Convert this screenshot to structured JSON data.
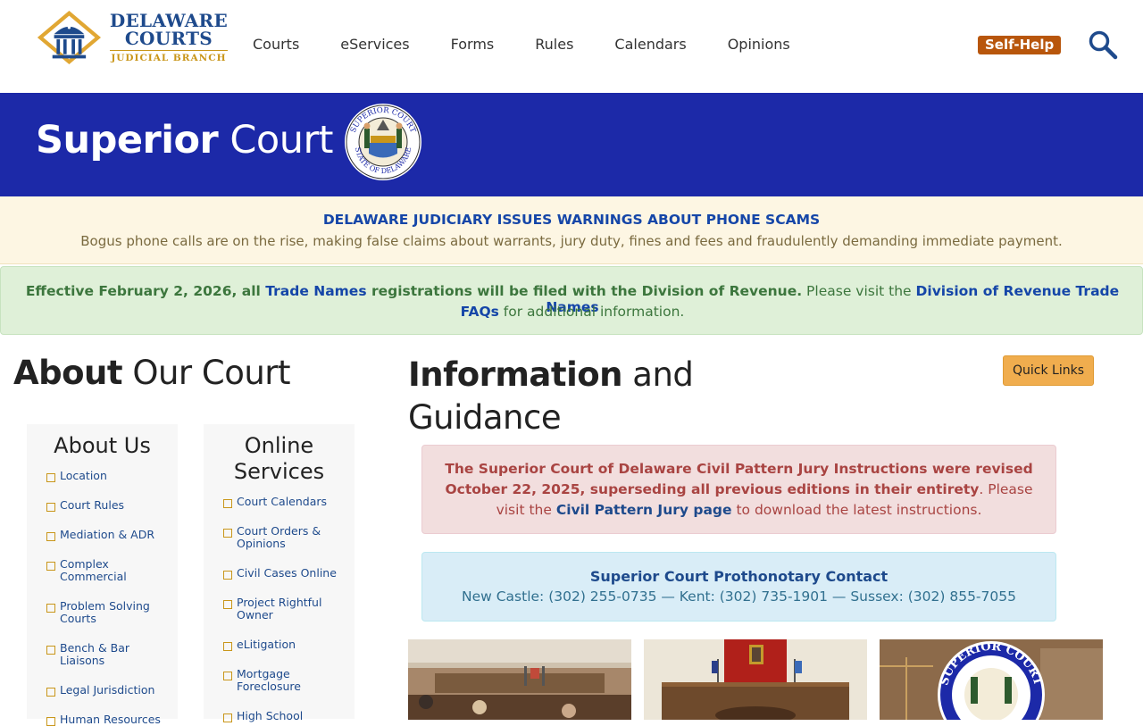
{
  "header": {
    "logo": {
      "line1": "DELAWARE",
      "line2": "COURTS",
      "line3": "JUDICIAL BRANCH"
    },
    "nav": [
      "Courts",
      "eServices",
      "Forms",
      "Rules",
      "Calendars",
      "Opinions"
    ],
    "self_help": "Self-Help",
    "search_icon": "search-icon"
  },
  "banner": {
    "title_bold": "Superior",
    "title_light": "Court",
    "seal_text_top": "SUPERIOR COURT",
    "seal_text_bottom": "STATE OF DELAWARE"
  },
  "alert_scam": {
    "title": "DELAWARE JUDICIARY ISSUES WARNINGS ABOUT PHONE SCAMS",
    "text": "Bogus phone calls are on the rise, making false claims about warrants, jury duty, fines and fees and fraudulently demanding immediate payment."
  },
  "alert_trade": {
    "part1": "Effective February 2, 2026, all ",
    "link1": "Trade Names",
    "part2": " registrations will be filed with the Division of Revenue.",
    "part3": " Please visit the ",
    "link2a": "Division of Revenue Trade Names",
    "link2b": "FAQs",
    "part4": " for additional information."
  },
  "about": {
    "heading_bold": "About",
    "heading_light": " Our Court",
    "about_us": {
      "title": "About Us",
      "items": [
        "Location",
        "Court Rules",
        "Mediation & ADR",
        "Complex Commercial",
        "Problem Solving Courts",
        "Bench & Bar Liaisons",
        "Legal Jurisdiction",
        "Human Resources"
      ]
    },
    "online": {
      "title": "Online Services",
      "items": [
        "Court Calendars",
        "Court Orders & Opinions",
        "Civil Cases Online",
        "Project Rightful Owner",
        "eLitigation",
        "Mortgage Foreclosure",
        "High School"
      ]
    }
  },
  "info": {
    "heading_bold": "Information",
    "heading_light1": " and",
    "heading_light2": "Guidance",
    "quick_links": "Quick Links",
    "jury_alert": {
      "bold": "The Superior Court of Delaware Civil Pattern Jury Instructions were revised October 22, 2025, superseding all previous editions in their entirety",
      "text1": ". Please visit the ",
      "link": "Civil Pattern Jury page",
      "text2": " to download the latest instructions."
    },
    "contact": {
      "title": "Superior Court Prothonotary Contact",
      "text": "New Castle: (302) 255-0735 — Kent: (302) 735-1901 — Sussex: (302) 855-7055"
    }
  },
  "colors": {
    "banner": "#1c29a8",
    "brand_blue": "#1e4a8c",
    "self_help": "#b8560c",
    "quick_links": "#f0ad4e"
  }
}
